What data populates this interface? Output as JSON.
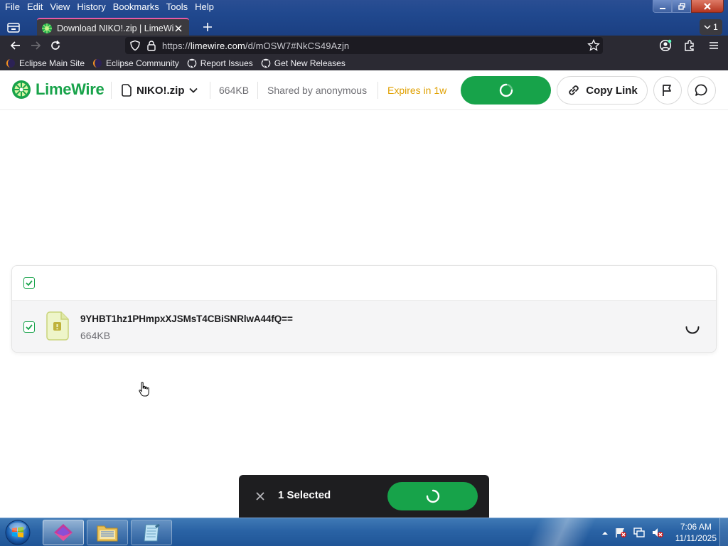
{
  "menu": [
    "File",
    "Edit",
    "View",
    "History",
    "Bookmarks",
    "Tools",
    "Help"
  ],
  "tab": {
    "title": "Download NIKO!.zip | LimeWire"
  },
  "tablist_count": "1",
  "url": {
    "prefix": "https://",
    "host": "limewire.com",
    "path": "/d/mOSW7#NkCS49Azjn"
  },
  "bookmarks": [
    "Eclipse Main Site",
    "Eclipse Community",
    "Report Issues",
    "Get New Releases"
  ],
  "header": {
    "brand": "LimeWire",
    "filename": "NIKO!.zip",
    "size": "664KB",
    "shared_by": "Shared by anonymous",
    "expires": "Expires in 1w",
    "copy_link": "Copy Link"
  },
  "files": [
    {
      "name": "9YHBT1hz1PHmpxXJSMsT4CBiSNRlwA44fQ==",
      "size": "664KB"
    }
  ],
  "selection": {
    "label": "1 Selected"
  },
  "clock": {
    "time": "7:06 AM",
    "date": "11/11/2025"
  },
  "colors": {
    "brand_green": "#17a34a",
    "expires_amber": "#e0a000",
    "tab_accent": "#e95aa4"
  }
}
